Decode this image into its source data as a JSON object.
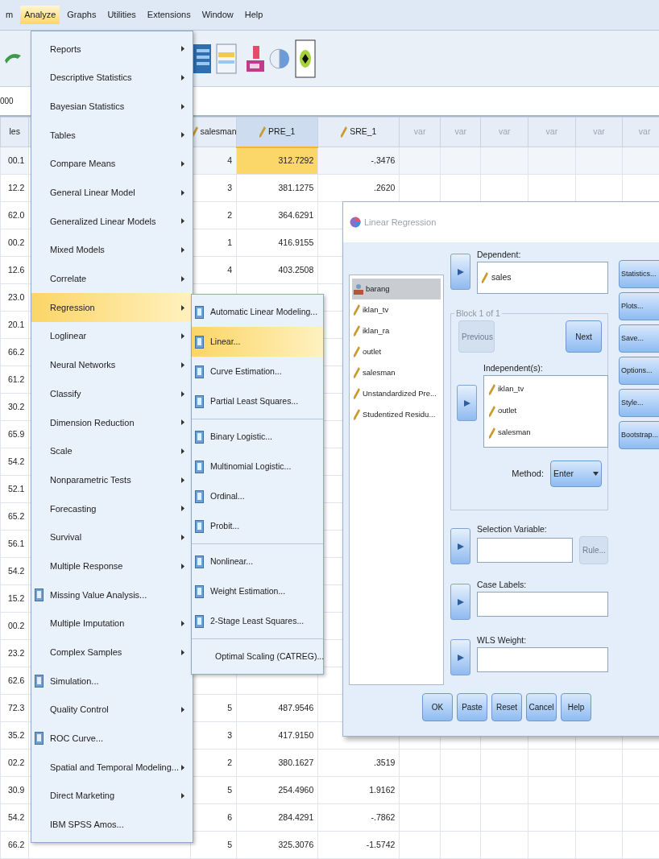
{
  "menubar": [
    {
      "label": "m",
      "selected": false
    },
    {
      "label": "Analyze",
      "selected": true
    },
    {
      "label": "Graphs",
      "selected": false
    },
    {
      "label": "Utilities",
      "selected": false
    },
    {
      "label": "Extensions",
      "selected": false
    },
    {
      "label": "Window",
      "selected": false
    },
    {
      "label": "Help",
      "selected": false
    }
  ],
  "cell_editor": {
    "value": "000"
  },
  "grid": {
    "columns": [
      {
        "label": "les",
        "kind": "plain",
        "current": false
      },
      {
        "label": "salesman",
        "kind": "scale",
        "current": false
      },
      {
        "label": "PRE_1",
        "kind": "scale",
        "current": true
      },
      {
        "label": "SRE_1",
        "kind": "scale",
        "current": false
      },
      {
        "label": "var",
        "kind": "empty",
        "current": false
      },
      {
        "label": "var",
        "kind": "empty",
        "current": false
      },
      {
        "label": "var",
        "kind": "empty",
        "current": false
      },
      {
        "label": "var",
        "kind": "empty",
        "current": false
      },
      {
        "label": "var",
        "kind": "empty",
        "current": false
      },
      {
        "label": "var",
        "kind": "empty",
        "current": false
      }
    ],
    "rows": [
      {
        "cells": [
          "00.1",
          "4",
          "312.7292",
          "-.3476"
        ],
        "selected": true
      },
      {
        "cells": [
          "12.2",
          "3",
          "381.1275",
          ".2620"
        ],
        "selected": false
      },
      {
        "cells": [
          "62.0",
          "2",
          "364.6291",
          null
        ],
        "selected": false
      },
      {
        "cells": [
          "00.2",
          "1",
          "416.9155",
          null
        ],
        "selected": false
      },
      {
        "cells": [
          "12.6",
          "4",
          "403.2508",
          null
        ],
        "selected": false
      },
      {
        "cells": [
          "23.0",
          null,
          null,
          null
        ],
        "selected": false
      },
      {
        "cells": [
          "20.1",
          null,
          null,
          null
        ],
        "selected": false
      },
      {
        "cells": [
          "66.2",
          null,
          null,
          null
        ],
        "selected": false
      },
      {
        "cells": [
          "61.2",
          null,
          null,
          null
        ],
        "selected": false
      },
      {
        "cells": [
          "30.2",
          null,
          null,
          null
        ],
        "selected": false
      },
      {
        "cells": [
          "65.9",
          null,
          null,
          null
        ],
        "selected": false
      },
      {
        "cells": [
          "54.2",
          null,
          null,
          null
        ],
        "selected": false
      },
      {
        "cells": [
          "52.1",
          null,
          null,
          null
        ],
        "selected": false
      },
      {
        "cells": [
          "65.2",
          null,
          null,
          null
        ],
        "selected": false
      },
      {
        "cells": [
          "56.1",
          null,
          null,
          null
        ],
        "selected": false
      },
      {
        "cells": [
          "54.2",
          null,
          null,
          null
        ],
        "selected": false
      },
      {
        "cells": [
          "15.2",
          null,
          null,
          null
        ],
        "selected": false
      },
      {
        "cells": [
          "00.2",
          null,
          null,
          null
        ],
        "selected": false
      },
      {
        "cells": [
          "23.2",
          null,
          null,
          null
        ],
        "selected": false
      },
      {
        "cells": [
          "62.6",
          null,
          null,
          null
        ],
        "selected": false
      },
      {
        "cells": [
          "72.3",
          "5",
          "487.9546",
          null
        ],
        "selected": false
      },
      {
        "cells": [
          "35.2",
          "3",
          "417.9150",
          null
        ],
        "selected": false
      },
      {
        "cells": [
          "02.2",
          "2",
          "380.1627",
          ".3519"
        ],
        "selected": false
      },
      {
        "cells": [
          "30.9",
          "5",
          "254.4960",
          "1.9162"
        ],
        "selected": false
      },
      {
        "cells": [
          "54.2",
          "6",
          "284.4291",
          "-.7862"
        ],
        "selected": false
      },
      {
        "cells": [
          "66.2",
          "5",
          "325.3076",
          "-1.5742"
        ],
        "selected": false
      }
    ]
  },
  "analyze_menu": [
    {
      "label": "Reports",
      "kind": "submenu",
      "selected": false
    },
    {
      "label": "Descriptive Statistics",
      "kind": "submenu",
      "selected": false
    },
    {
      "label": "Bayesian Statistics",
      "kind": "submenu",
      "selected": false
    },
    {
      "label": "Tables",
      "kind": "submenu",
      "selected": false
    },
    {
      "label": "Compare Means",
      "kind": "submenu",
      "selected": false
    },
    {
      "label": "General Linear Model",
      "kind": "submenu",
      "selected": false
    },
    {
      "label": "Generalized Linear Models",
      "kind": "submenu",
      "selected": false
    },
    {
      "label": "Mixed Models",
      "kind": "submenu",
      "selected": false
    },
    {
      "label": "Correlate",
      "kind": "submenu",
      "selected": false
    },
    {
      "label": "Regression",
      "kind": "submenu",
      "selected": true
    },
    {
      "label": "Loglinear",
      "kind": "submenu",
      "selected": false
    },
    {
      "label": "Neural Networks",
      "kind": "submenu",
      "selected": false
    },
    {
      "label": "Classify",
      "kind": "submenu",
      "selected": false
    },
    {
      "label": "Dimension Reduction",
      "kind": "submenu",
      "selected": false
    },
    {
      "label": "Scale",
      "kind": "submenu",
      "selected": false
    },
    {
      "label": "Nonparametric Tests",
      "kind": "submenu",
      "selected": false
    },
    {
      "label": "Forecasting",
      "kind": "submenu",
      "selected": false
    },
    {
      "label": "Survival",
      "kind": "submenu",
      "selected": false
    },
    {
      "label": "Multiple Response",
      "kind": "submenu",
      "selected": false
    },
    {
      "label": "Missing Value Analysis...",
      "kind": "icon",
      "selected": false
    },
    {
      "label": "Multiple Imputation",
      "kind": "submenu",
      "selected": false
    },
    {
      "label": "Complex Samples",
      "kind": "submenu",
      "selected": false
    },
    {
      "label": "Simulation...",
      "kind": "icon",
      "selected": false
    },
    {
      "label": "Quality Control",
      "kind": "submenu",
      "selected": false
    },
    {
      "label": "ROC Curve...",
      "kind": "icon",
      "selected": false
    },
    {
      "label": "Spatial and Temporal Modeling...",
      "kind": "submenu",
      "selected": false
    },
    {
      "label": "Direct Marketing",
      "kind": "submenu",
      "selected": false
    },
    {
      "label": "IBM SPSS Amos...",
      "kind": "plain",
      "selected": false
    }
  ],
  "regression_menu": [
    [
      {
        "label": "Automatic Linear Modeling...",
        "kind": "icon",
        "selected": false
      },
      {
        "label": "Linear...",
        "kind": "icon",
        "selected": true
      },
      {
        "label": "Curve Estimation...",
        "kind": "icon",
        "selected": false
      },
      {
        "label": "Partial Least Squares...",
        "kind": "icon",
        "selected": false
      }
    ],
    [
      {
        "label": "Binary Logistic...",
        "kind": "icon",
        "selected": false
      },
      {
        "label": "Multinomial Logistic...",
        "kind": "icon",
        "selected": false
      },
      {
        "label": "Ordinal...",
        "kind": "icon",
        "selected": false
      },
      {
        "label": "Probit...",
        "kind": "icon",
        "selected": false
      }
    ],
    [
      {
        "label": "Nonlinear...",
        "kind": "icon",
        "selected": false
      },
      {
        "label": "Weight Estimation...",
        "kind": "icon",
        "selected": false
      },
      {
        "label": "2-Stage Least Squares...",
        "kind": "icon",
        "selected": false
      }
    ],
    [
      {
        "label": "Optimal Scaling (CATREG)...",
        "kind": "plain",
        "selected": false
      }
    ]
  ],
  "dialog": {
    "title": "Linear Regression",
    "variables": [
      {
        "label": "barang",
        "kind": "nominal",
        "selected": true
      },
      {
        "label": "iklan_tv",
        "kind": "scale",
        "selected": false
      },
      {
        "label": "iklan_ra",
        "kind": "scale",
        "selected": false
      },
      {
        "label": "outlet",
        "kind": "scale",
        "selected": false
      },
      {
        "label": "salesman",
        "kind": "scale",
        "selected": false
      },
      {
        "label": "Unstandardized Pre...",
        "kind": "scale",
        "selected": false
      },
      {
        "label": "Studentized Residu...",
        "kind": "scale",
        "selected": false
      }
    ],
    "dependent": {
      "label": "Dependent:",
      "value": "sales"
    },
    "block": {
      "label": "Block 1 of 1",
      "previous": {
        "label": "Previous",
        "disabled": true
      },
      "next": {
        "label": "Next",
        "disabled": false
      },
      "independents_label": "Independent(s):",
      "independents": [
        "iklan_tv",
        "outlet",
        "salesman"
      ],
      "method_label": "Method:",
      "method": "Enter"
    },
    "selection_variable": {
      "label": "Selection Variable:",
      "rule": {
        "label": "Rule...",
        "disabled": true
      }
    },
    "case_labels": {
      "label": "Case Labels:"
    },
    "wls_weight": {
      "label": "WLS Weight:"
    },
    "side_buttons": [
      "Statistics...",
      "Plots...",
      "Save...",
      "Options...",
      "Style...",
      "Bootstrap..."
    ],
    "footer_buttons": [
      "OK",
      "Paste",
      "Reset",
      "Cancel",
      "Help"
    ]
  }
}
